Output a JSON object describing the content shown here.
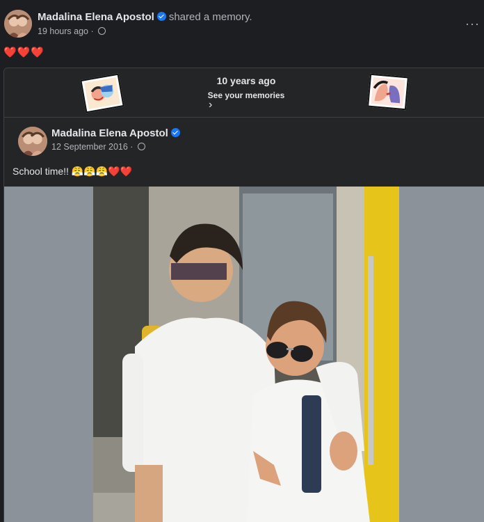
{
  "post": {
    "author": "Madalina Elena Apostol",
    "action": "shared a memory.",
    "time": "19 hours ago",
    "text": "❤️❤️❤️",
    "more": "···"
  },
  "memory": {
    "title": "10 years ago",
    "subtitle": "See your memories",
    "chevron": "›",
    "original": {
      "author": "Madalina Elena Apostol",
      "date": "12 September 2016",
      "text": "School time!! 😤😤😤❤️❤️"
    }
  },
  "icons": {
    "verified": "verified-badge-icon",
    "privacy": "globe-icon",
    "more": "more-options-icon"
  },
  "colors": {
    "background": "#1c1e21",
    "card": "#242526",
    "verified": "#1877f2",
    "heart": "#e41e3f",
    "photo_side": "#8b929a"
  }
}
